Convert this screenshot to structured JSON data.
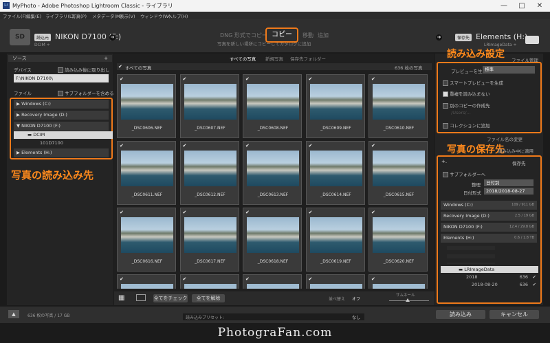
{
  "window": {
    "title": "MyPhoto - Adobe Photoshop Lightroom Classic - ライブラリ",
    "minimize": "—",
    "maximize": "□",
    "close": "✕"
  },
  "menu": [
    "ファイル(F)",
    "編集(E)",
    "ライブラリ(L)",
    "写真(P)",
    "メタデータ(M)",
    "表示(V)",
    "ウィンドウ(W)",
    "ヘルプ(H)"
  ],
  "header": {
    "source_tag": "読込元",
    "source_name": "NIKON D7100 (F:)",
    "source_path": "DCIM ÷",
    "modes": [
      "DNG 形式でコピー",
      "コピー",
      "移動",
      "追加"
    ],
    "mode_desc": "写真を新しい場所にコピーしてカタログに追加",
    "copy_label": "コピー",
    "dest_tag": "保存先",
    "dest_name": "Elements (H:)",
    "dest_path": "LRImageData ÷"
  },
  "left": {
    "source_header": "ソース",
    "add": "+",
    "device_label": "デバイス",
    "eject_label": "読み込み後に取り出し",
    "device_value": "F:\\NIKON D7100\\",
    "files_label": "ファイル",
    "subfolders_label": "サブフォルダーを含める",
    "volumes": [
      {
        "name": "Windows (C:)",
        "arrow": "▶"
      },
      {
        "name": "Recovery Image (D:)",
        "arrow": "▶"
      },
      {
        "name": "NIKON D7100 (F:)",
        "arrow": "▼"
      }
    ],
    "folder_dcim": "DCIM",
    "folder_sub": "101D7100",
    "volume_elements": "Elements (H:)",
    "volume_elements_arrow": "▶",
    "annotation": "写真の読み込み先"
  },
  "center": {
    "tabs": [
      "すべての写真",
      "新規写真",
      "保存先フォルダー"
    ],
    "all_photos": "すべての写真",
    "count": "636 枚の写真",
    "photos": [
      "_DSC0606.NEF",
      "_DSC0607.NEF",
      "_DSC0608.NEF",
      "_DSC0609.NEF",
      "_DSC0610.NEF",
      "_DSC0611.NEF",
      "_DSC0612.NEF",
      "_DSC0613.NEF",
      "_DSC0614.NEF",
      "_DSC0615.NEF",
      "_DSC0616.NEF",
      "_DSC0617.NEF",
      "_DSC0618.NEF",
      "_DSC0619.NEF",
      "_DSC0620.NEF"
    ],
    "check_all": "全てをチェック",
    "uncheck_all": "全てを解除",
    "sort_label": "並べ替え",
    "sort_value": "オフ",
    "thumb_label": "サムネール"
  },
  "right": {
    "section_file_handling": "ファイル管理",
    "preview_label": "プレビューを生成",
    "preview_value": "標準",
    "smart_preview": "スマートプレビューを生成",
    "no_duplicates": "重複を読み込まない",
    "second_copy": "別のコピーの作成先",
    "second_copy_path": "/Users/...",
    "add_collection": "コレクションに追加",
    "annotation_settings": "読み込み設定",
    "file_rename": "ファイル名の変更",
    "apply_during": "読み込み中に適用",
    "dest_header": "保存先",
    "dest_add": "+.",
    "subfolder": "サブフォルダーへ",
    "organize_label": "整理",
    "organize_value": "日付別",
    "date_format_label": "日付形式",
    "date_format_value": "2018/2018-08-27",
    "volumes": [
      {
        "name": "Windows (C:)",
        "size": "109 / 911 GB"
      },
      {
        "name": "Recovery Image (D:)",
        "size": "2.5 / 19 GB"
      },
      {
        "name": "NIKON D7100 (F:)",
        "size": "12.4 / 29.8 GB"
      },
      {
        "name": "Elements (H:)",
        "size": "0.6 / 1.8 TB"
      }
    ],
    "folder_lr": "LRImageData",
    "folder_2018": "2018",
    "count_2018": "636",
    "folder_date": "2018-08-20",
    "count_date": "636",
    "annotation_dest": "写真の保存先"
  },
  "bottom": {
    "status": "636 枚の写真 / 17 GB",
    "preset_label": "読み込みプリセット:",
    "preset_value": "なし",
    "import": "読み込み",
    "cancel": "キャンセル",
    "watermark": "PhotograFan.com"
  },
  "colors": {
    "annotation": "#f07a1a",
    "bg": "#1b1b1b",
    "panel": "#242424"
  }
}
